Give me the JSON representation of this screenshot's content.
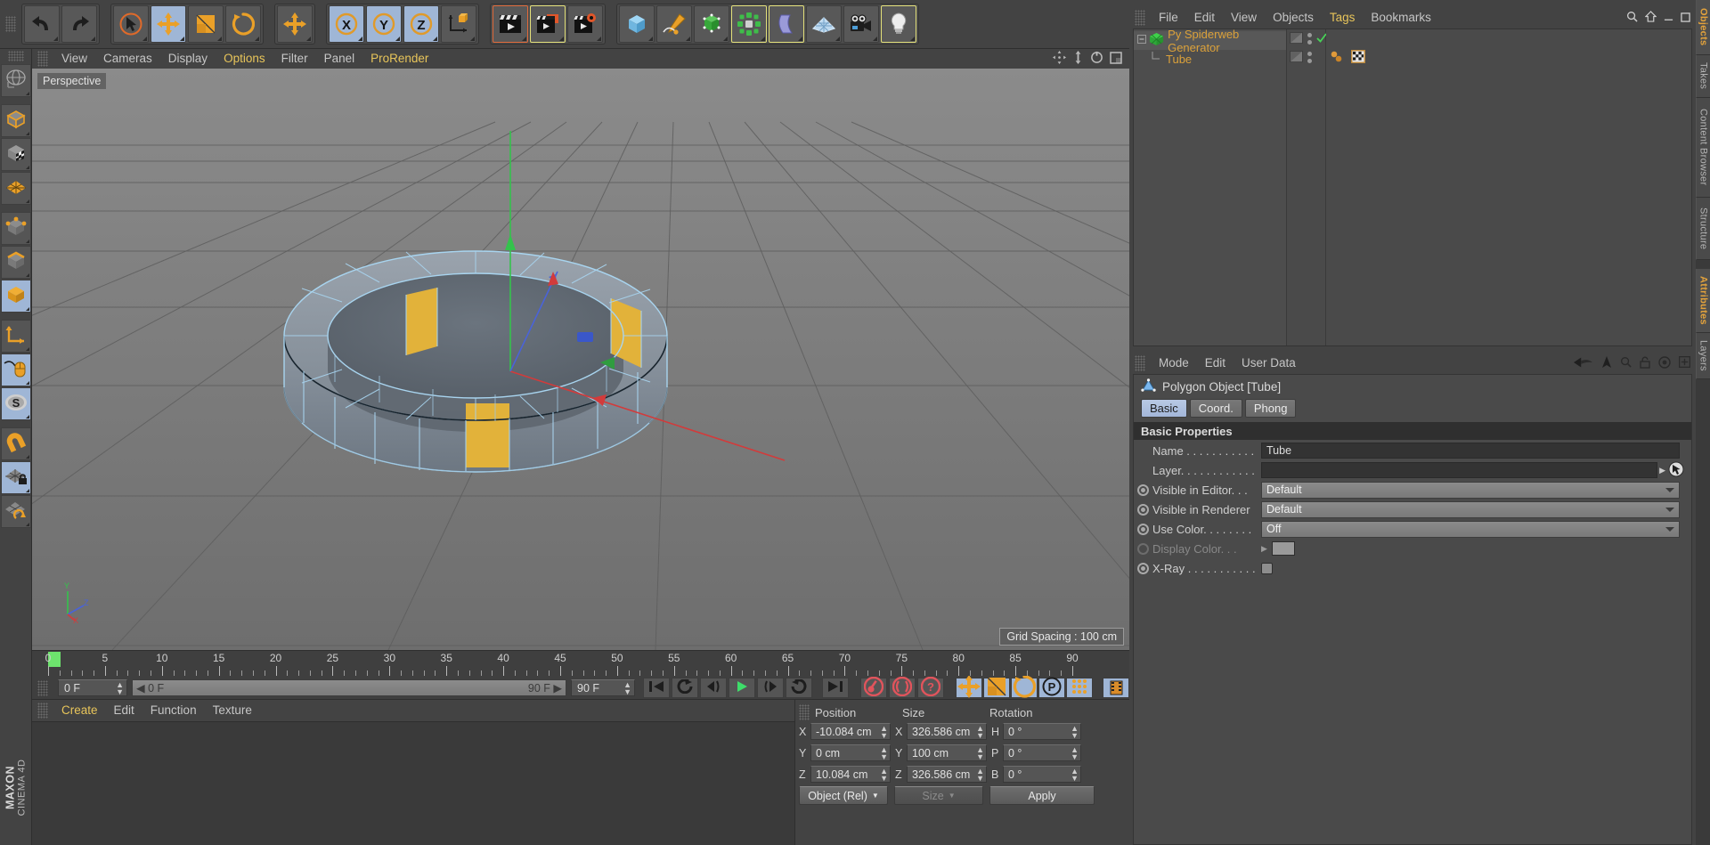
{
  "app": {
    "brand_top": "MAXON",
    "brand_bottom": "CINEMA 4D"
  },
  "toolbar": {
    "groups": [
      {
        "name": "history",
        "buttons": [
          {
            "name": "undo-button",
            "icon": "undo-icon",
            "state": "normal"
          },
          {
            "name": "redo-button",
            "icon": "redo-icon",
            "state": "normal"
          }
        ]
      },
      {
        "name": "transform",
        "buttons": [
          {
            "name": "select-tool-button",
            "icon": "cursor-select-icon",
            "state": "normal"
          },
          {
            "name": "move-tool-button",
            "icon": "move-arrows-icon",
            "state": "active"
          },
          {
            "name": "scale-tool-button",
            "icon": "scale-box-icon",
            "state": "normal"
          },
          {
            "name": "rotate-tool-button",
            "icon": "rotate-circle-icon",
            "state": "normal"
          }
        ]
      },
      {
        "name": "world-move",
        "buttons": [
          {
            "name": "move-world-button",
            "icon": "move-arrows-icon",
            "state": "normal"
          }
        ]
      },
      {
        "name": "axis-locks",
        "buttons": [
          {
            "name": "lock-x-axis-button",
            "icon": "x-axis-icon",
            "state": "active"
          },
          {
            "name": "lock-y-axis-button",
            "icon": "y-axis-icon",
            "state": "active"
          },
          {
            "name": "lock-z-axis-button",
            "icon": "z-axis-icon",
            "state": "active"
          },
          {
            "name": "coordinate-system-button",
            "icon": "world-object-axis-icon",
            "state": "normal"
          }
        ]
      },
      {
        "name": "render",
        "buttons": [
          {
            "name": "render-view-button",
            "icon": "clapperboard-icon",
            "state": "red-outline"
          },
          {
            "name": "render-to-picture-viewer-button",
            "icon": "clapperboard-picture-icon",
            "state": "highlight-outline"
          },
          {
            "name": "render-settings-button",
            "icon": "clapperboard-gear-icon",
            "state": "normal"
          }
        ]
      },
      {
        "name": "create",
        "buttons": [
          {
            "name": "add-cube-button",
            "icon": "cube-icon",
            "state": "normal"
          },
          {
            "name": "add-spline-button",
            "icon": "pen-spline-icon",
            "state": "normal"
          },
          {
            "name": "add-generator-button",
            "icon": "generator-nurbs-icon",
            "state": "normal"
          },
          {
            "name": "add-mograph-button",
            "icon": "mograph-cloner-icon",
            "state": "highlight-outline"
          },
          {
            "name": "add-deformer-button",
            "icon": "bend-deformer-icon",
            "state": "highlight-outline"
          },
          {
            "name": "add-floor-button",
            "icon": "floor-grid-icon",
            "state": "normal"
          },
          {
            "name": "add-camera-button",
            "icon": "camera-icon",
            "state": "normal"
          },
          {
            "name": "add-light-button",
            "icon": "light-bulb-icon",
            "state": "highlight-outline"
          }
        ]
      }
    ]
  },
  "left_tools": [
    {
      "name": "make-editable-button",
      "icon": "globe-axis-icon",
      "state": "normal"
    },
    {
      "name": "model-mode-button",
      "icon": "model-cube-icon",
      "state": "normal"
    },
    {
      "name": "texture-mode-button",
      "icon": "texture-checker-cube-icon",
      "state": "normal"
    },
    {
      "name": "workplane-mode-button",
      "icon": "workplane-grid-icon",
      "state": "normal"
    },
    {
      "name": "points-mode-button",
      "icon": "points-cube-icon",
      "state": "normal"
    },
    {
      "name": "edges-mode-button",
      "icon": "edges-cube-icon",
      "state": "normal"
    },
    {
      "name": "polygons-mode-button",
      "icon": "polygons-cube-icon",
      "state": "active"
    },
    {
      "name": "enable-axis-button",
      "icon": "axis-arrows-icon",
      "state": "normal"
    },
    {
      "name": "viewport-solo-button",
      "icon": "mouse-cursor-icon",
      "state": "active"
    },
    {
      "name": "snap-button",
      "icon": "snap-s-icon",
      "state": "active"
    },
    {
      "name": "magnet-button",
      "icon": "magnet-icon",
      "state": "normal"
    },
    {
      "name": "lock-workplane-button",
      "icon": "workplane-lock-icon",
      "state": "active"
    },
    {
      "name": "planar-workplane-button",
      "icon": "workplane-rotate-icon",
      "state": "normal"
    }
  ],
  "viewport": {
    "menu": [
      {
        "label": "View",
        "highlight": false
      },
      {
        "label": "Cameras",
        "highlight": false
      },
      {
        "label": "Display",
        "highlight": false
      },
      {
        "label": "Options",
        "highlight": true
      },
      {
        "label": "Filter",
        "highlight": false
      },
      {
        "label": "Panel",
        "highlight": false
      },
      {
        "label": "ProRender",
        "highlight": true
      }
    ],
    "label": "Perspective",
    "grid_spacing": "Grid Spacing : 100 cm",
    "nav_icons": [
      "pan-icon",
      "dolly-icon",
      "orbit-icon",
      "maximize-viewport-icon"
    ],
    "axis_labels": {
      "y": "Y",
      "z": "Z",
      "x": "X"
    }
  },
  "timeline": {
    "ticks": [
      "0",
      "5",
      "10",
      "15",
      "20",
      "25",
      "30",
      "35",
      "40",
      "45",
      "50",
      "55",
      "60",
      "65",
      "70",
      "75",
      "80",
      "85",
      "90"
    ],
    "current_frame_marker": "0",
    "current_frame_field": "0 F",
    "range_start": "0 F",
    "range_end": "90 F",
    "end_frame_field": "90 F",
    "preview_frame_field": "0 F",
    "transport": [
      {
        "name": "go-to-start-button",
        "icon": "skip-start-icon"
      },
      {
        "name": "previous-keyframe-button",
        "icon": "prev-key-icon"
      },
      {
        "name": "step-back-button",
        "icon": "step-back-icon"
      },
      {
        "name": "play-button",
        "icon": "play-icon"
      },
      {
        "name": "step-forward-button",
        "icon": "step-forward-icon"
      },
      {
        "name": "next-keyframe-button",
        "icon": "next-key-icon"
      },
      {
        "name": "go-to-end-button",
        "icon": "skip-end-icon"
      }
    ],
    "record_group": [
      {
        "name": "record-keyframe-button",
        "icon": "record-key-icon"
      },
      {
        "name": "autokeying-button",
        "icon": "autokey-icon"
      },
      {
        "name": "keyframe-selection-button",
        "icon": "key-question-icon"
      }
    ],
    "key_toggles": [
      {
        "name": "position-key-toggle",
        "icon": "move-arrows-icon"
      },
      {
        "name": "scale-key-toggle",
        "icon": "scale-box-icon"
      },
      {
        "name": "rotation-key-toggle",
        "icon": "rotate-circle-icon"
      },
      {
        "name": "param-key-toggle",
        "icon": "param-p-icon"
      },
      {
        "name": "pla-key-toggle",
        "icon": "point-level-anim-icon"
      }
    ],
    "timeline_toggle": {
      "name": "animation-mode-toggle",
      "icon": "filmstrip-icon"
    }
  },
  "material_manager": {
    "menu": [
      {
        "label": "Create",
        "highlight": true
      },
      {
        "label": "Edit",
        "highlight": false
      },
      {
        "label": "Function",
        "highlight": false
      },
      {
        "label": "Texture",
        "highlight": false
      }
    ]
  },
  "coordinates": {
    "headers": [
      "Position",
      "Size",
      "Rotation"
    ],
    "rows": [
      {
        "pos_label": "X",
        "pos_value": "-10.084 cm",
        "size_label": "X",
        "size_value": "326.586 cm",
        "rot_label": "H",
        "rot_value": "0 °"
      },
      {
        "pos_label": "Y",
        "pos_value": "0 cm",
        "size_label": "Y",
        "size_value": "100 cm",
        "rot_label": "P",
        "rot_value": "0 °"
      },
      {
        "pos_label": "Z",
        "pos_value": "10.084 cm",
        "size_label": "Z",
        "size_value": "326.586 cm",
        "rot_label": "B",
        "rot_value": "0 °"
      }
    ],
    "mode_dropdown": "Object (Rel)",
    "size_dropdown": "Size",
    "apply_button": "Apply"
  },
  "object_manager": {
    "menu": [
      {
        "label": "File",
        "highlight": false
      },
      {
        "label": "Edit",
        "highlight": false
      },
      {
        "label": "View",
        "highlight": false
      },
      {
        "label": "Objects",
        "highlight": false
      },
      {
        "label": "Tags",
        "highlight": true
      },
      {
        "label": "Bookmarks",
        "highlight": false
      }
    ],
    "tools": [
      "search-icon",
      "home-icon",
      "minimize-icon",
      "maximize-icon"
    ],
    "items": [
      {
        "label": "Py Spiderweb Generator",
        "icon": "python-generator-icon",
        "selected": true,
        "depth": 0,
        "check": true
      },
      {
        "label": "Tube",
        "icon": "polygon-object-icon",
        "selected": false,
        "depth": 1,
        "check": false,
        "tags": [
          "phong-tag-icon",
          "texture-tag-icon"
        ]
      }
    ]
  },
  "attributes": {
    "menu": [
      {
        "label": "Mode",
        "highlight": false
      },
      {
        "label": "Edit",
        "highlight": false
      },
      {
        "label": "User Data",
        "highlight": false
      }
    ],
    "tools": [
      "back-arrow-icon",
      "up-arrow-icon",
      "search-icon",
      "lock-icon",
      "target-icon",
      "plus-icon"
    ],
    "object_title": "Polygon Object [Tube]",
    "object_icon": "polygon-object-icon",
    "tabs": [
      {
        "label": "Basic",
        "active": true
      },
      {
        "label": "Coord.",
        "active": false
      },
      {
        "label": "Phong",
        "active": false
      }
    ],
    "section_title": "Basic Properties",
    "properties": [
      {
        "label": "Name . . . . . . . . . . .",
        "type": "text",
        "value": "Tube",
        "radio": false,
        "dim": false
      },
      {
        "label": "Layer. . . . . . . . . . . .",
        "type": "layer",
        "value": "",
        "radio": false,
        "dim": false
      },
      {
        "label": "Visible in Editor. . .",
        "type": "select",
        "value": "Default",
        "radio": true,
        "dim": false
      },
      {
        "label": "Visible in Renderer",
        "type": "select",
        "value": "Default",
        "radio": true,
        "dim": false
      },
      {
        "label": "Use Color. . . . . . . .",
        "type": "select",
        "value": "Off",
        "radio": true,
        "dim": false
      },
      {
        "label": "Display Color. . .",
        "type": "color",
        "value": "",
        "radio": true,
        "dim": true
      },
      {
        "label": "X-Ray . . . . . . . . . . .",
        "type": "check",
        "value": "",
        "radio": true,
        "dim": false
      }
    ]
  },
  "side_tabs_top": [
    {
      "label": "Objects",
      "active": true
    },
    {
      "label": "Takes",
      "active": false
    },
    {
      "label": "Content Browser",
      "active": false
    },
    {
      "label": "Structure",
      "active": false
    }
  ],
  "side_tabs_bottom": [
    {
      "label": "Attributes",
      "active": true
    },
    {
      "label": "Layers",
      "active": false
    }
  ],
  "colors": {
    "accent_orange": "#dba13a",
    "highlight_yellow": "#e8c55a",
    "active_blue": "#9fb6d6",
    "panel_bg": "#434343"
  }
}
